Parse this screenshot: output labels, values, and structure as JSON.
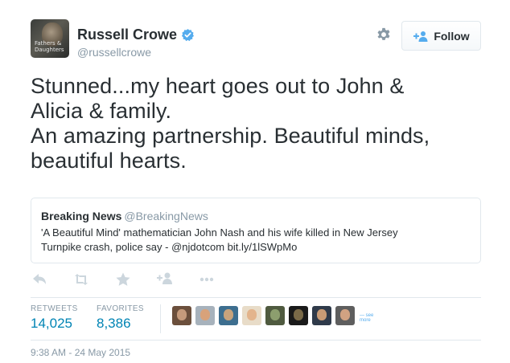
{
  "user": {
    "display_name": "Russell Crowe",
    "screen_name": "@russellcrowe",
    "avatar_caption": "Fathers & Daughters",
    "verified_icon": "verified-badge-icon"
  },
  "header": {
    "gear_icon": "gear-icon",
    "follow_label": "Follow",
    "follow_icon": "add-person-icon"
  },
  "tweet": {
    "text": "Stunned...my heart goes out to John &\nAlicia & family.\nAn amazing partnership. Beautiful minds,\nbeautiful hearts."
  },
  "quote": {
    "name": "Breaking News",
    "handle": "@BreakingNews",
    "text": "'A Beautiful Mind' mathematician John Nash and his wife killed in New Jersey Turnpike crash, police say - @njdotcom bit.ly/1lSWpMo"
  },
  "actions": [
    {
      "name": "reply-icon"
    },
    {
      "name": "retweet-icon"
    },
    {
      "name": "favorite-star-icon"
    },
    {
      "name": "add-person-icon"
    },
    {
      "name": "more-options-icon"
    }
  ],
  "stats": {
    "retweets_label": "RETWEETS",
    "retweets_value": "14,025",
    "favorites_label": "FAVORITES",
    "favorites_value": "8,386",
    "more_faves_label": "— see more"
  },
  "colors": {
    "link": "#0084b4",
    "muted": "#8899a6",
    "verified": "#55acee",
    "text": "#292f33"
  },
  "timestamp": "9:38 AM - 24 May 2015"
}
